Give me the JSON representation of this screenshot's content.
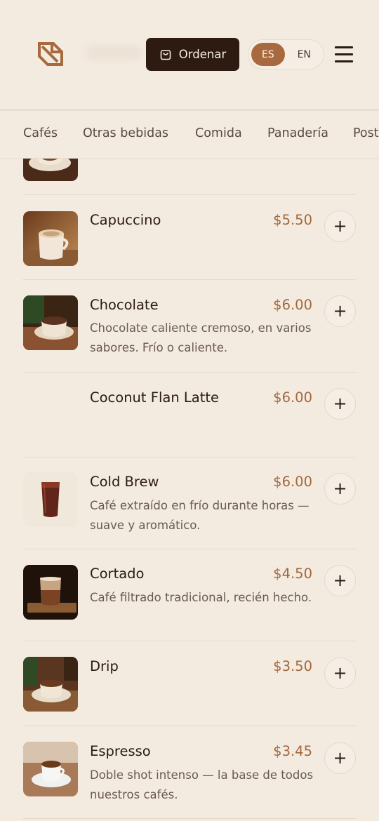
{
  "header": {
    "order_label": "Ordenar",
    "lang_options": [
      "ES",
      "EN"
    ],
    "lang_selected": "ES"
  },
  "categories": [
    "Cafés",
    "Otras bebidas",
    "Comida",
    "Panadería",
    "Post"
  ],
  "items": [
    {
      "name": "Capuccino",
      "price": "$5.50",
      "description": ""
    },
    {
      "name": "Chocolate",
      "price": "$6.00",
      "description": "Chocolate caliente cremoso, en varios sabores. Frío o caliente."
    },
    {
      "name": "Coconut Flan Latte",
      "price": "$6.00",
      "description": ""
    },
    {
      "name": "Cold Brew",
      "price": "$6.00",
      "description": "Café extraído en frío durante horas — suave y aromático."
    },
    {
      "name": "Cortado",
      "price": "$4.50",
      "description": "Café filtrado tradicional, recién hecho."
    },
    {
      "name": "Drip",
      "price": "$3.50",
      "description": ""
    },
    {
      "name": "Espresso",
      "price": "$3.45",
      "description": "Doble shot intenso — la base de todos nuestros cafés."
    }
  ],
  "add_symbol": "+",
  "colors": {
    "background": "#f4ebe0",
    "accent": "#a8693e",
    "price": "#a2683d",
    "dark_button": "#2d1a10"
  }
}
